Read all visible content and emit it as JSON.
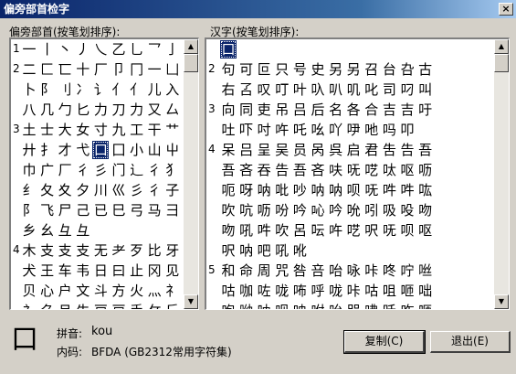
{
  "window": {
    "title": "偏旁部首检字",
    "close_label": "×"
  },
  "left_panel": {
    "label": "偏旁部首(按笔划排序):",
    "rows": [
      {
        "num": "1",
        "chars": [
          "一",
          "丨",
          "丶",
          "丿",
          "乀",
          "乙",
          "乚",
          "乛",
          "亅"
        ]
      },
      {
        "num": "2",
        "chars": [
          "二",
          "匚",
          "匸",
          "十",
          "厂",
          "卩",
          "冂",
          "一",
          "凵"
        ]
      },
      {
        "num": "",
        "chars": [
          "卜",
          "阝",
          "刂",
          "冫",
          "讠",
          "亻",
          "亻",
          "儿",
          "入"
        ]
      },
      {
        "num": "",
        "chars": [
          "八",
          "几",
          "勹",
          "匕",
          "力",
          "刀",
          "力",
          "又",
          "厶"
        ]
      },
      {
        "num": "3",
        "chars": [
          "土",
          "士",
          "大",
          "女",
          "寸",
          "九",
          "工",
          "干",
          "艹"
        ]
      },
      {
        "num": "",
        "chars": [
          "廾",
          "扌",
          "才",
          "弋",
          "口",
          "囗",
          "小",
          "山",
          "屮"
        ]
      },
      {
        "num": "",
        "chars": [
          "巾",
          "广",
          "厂",
          "彳",
          "彡",
          "门",
          "辶",
          "彳",
          "犭"
        ]
      },
      {
        "num": "",
        "chars": [
          "纟",
          "夂",
          "夊",
          "夕",
          "川",
          "巛",
          "彡",
          "彳",
          "子"
        ]
      },
      {
        "num": "",
        "chars": [
          "阝",
          "飞",
          "尸",
          "己",
          "已",
          "巳",
          "弓",
          "马",
          "彐"
        ]
      },
      {
        "num": "",
        "chars": [
          "乡",
          "幺",
          "彑",
          "彑",
          "",
          "",
          "",
          "",
          ""
        ]
      },
      {
        "num": "4",
        "chars": [
          "木",
          "支",
          "支",
          "支",
          "无",
          "耂",
          "歹",
          "比",
          "牙"
        ]
      },
      {
        "num": "",
        "chars": [
          "犬",
          "王",
          "车",
          "韦",
          "日",
          "曰",
          "止",
          "冈",
          "见"
        ]
      },
      {
        "num": "",
        "chars": [
          "贝",
          "心",
          "户",
          "文",
          "斗",
          "方",
          "火",
          "灬",
          "礻"
        ]
      },
      {
        "num": "",
        "chars": [
          "礻",
          "⺈",
          "月",
          "牛",
          "戸",
          "戸",
          "手",
          "攵",
          "斤"
        ]
      }
    ],
    "selected": "口"
  },
  "right_panel": {
    "label": "汉字(按笔划排序):",
    "rows": [
      {
        "num": "",
        "chars": [
          "口",
          "",
          "",
          "",
          "",
          "",
          "",
          "",
          "",
          "",
          "",
          ""
        ]
      },
      {
        "num": "2",
        "chars": [
          "句",
          "可",
          "叵",
          "只",
          "号",
          "史",
          "另",
          "另",
          "召",
          "台",
          "叴",
          "古"
        ]
      },
      {
        "num": "",
        "chars": [
          "右",
          "叾",
          "叹",
          "叮",
          "叶",
          "叺",
          "叭",
          "叽",
          "叱",
          "司",
          "叼",
          "叫"
        ]
      },
      {
        "num": "3",
        "chars": [
          "向",
          "同",
          "吏",
          "吊",
          "吕",
          "后",
          "名",
          "各",
          "合",
          "吉",
          "吉",
          "吁"
        ]
      },
      {
        "num": "",
        "chars": [
          "吐",
          "吓",
          "吋",
          "吘",
          "吒",
          "吆",
          "吖",
          "吚",
          "吔",
          "吗",
          "叩",
          ""
        ]
      },
      {
        "num": "4",
        "chars": [
          "呆",
          "吕",
          "呈",
          "吴",
          "员",
          "呙",
          "呉",
          "启",
          "君",
          "吿",
          "告",
          "吾"
        ]
      },
      {
        "num": "",
        "chars": [
          "吾",
          "吝",
          "吞",
          "告",
          "吾",
          "吝",
          "呋",
          "呒",
          "呓",
          "呔",
          "呕",
          "呖"
        ]
      },
      {
        "num": "",
        "chars": [
          "呃",
          "呀",
          "呐",
          "吡",
          "吵",
          "呐",
          "呐",
          "呗",
          "呒",
          "吽",
          "吽",
          "吰"
        ]
      },
      {
        "num": "",
        "chars": [
          "吹",
          "吭",
          "呖",
          "吩",
          "吟",
          "吣",
          "吟",
          "吮",
          "吲",
          "吸",
          "吺",
          "吻"
        ]
      },
      {
        "num": "",
        "chars": [
          "吻",
          "吼",
          "吽",
          "吹",
          "呂",
          "呍",
          "吘",
          "呓",
          "呎",
          "呒",
          "呗",
          "呕"
        ]
      },
      {
        "num": "",
        "chars": [
          "呎",
          "呐",
          "吧",
          "吼",
          "吪",
          "",
          "",
          "",
          "",
          "",
          "",
          ""
        ]
      },
      {
        "num": "5",
        "chars": [
          "和",
          "命",
          "周",
          "咒",
          "咎",
          "咅",
          "咍",
          "咏",
          "咔",
          "咚",
          "咛",
          "咝"
        ]
      },
      {
        "num": "",
        "chars": [
          "咕",
          "咖",
          "咗",
          "咙",
          "咘",
          "呼",
          "咙",
          "咔",
          "咕",
          "咀",
          "咂",
          "咄"
        ]
      },
      {
        "num": "",
        "chars": [
          "咆",
          "呦",
          "呐",
          "呗",
          "咉",
          "咐",
          "咍",
          "咒",
          "咈",
          "咊",
          "咋",
          "咂"
        ]
      },
      {
        "num": "",
        "chars": [
          "哌",
          "咛",
          "咚",
          "咦",
          "咤",
          "咥",
          "咧",
          "咨",
          "咩",
          "咪",
          "咫",
          "咬"
        ]
      }
    ]
  },
  "bottom": {
    "big_char": "口",
    "pinyin_label": "拼音:",
    "pinyin_value": "kou",
    "code_label": "内码:",
    "code_value": "BFDA (GB2312常用字符集)",
    "copy_label": "复制(C)",
    "exit_label": "退出(E)"
  },
  "scroll_arrows": {
    "up": "▲",
    "down": "▼"
  }
}
